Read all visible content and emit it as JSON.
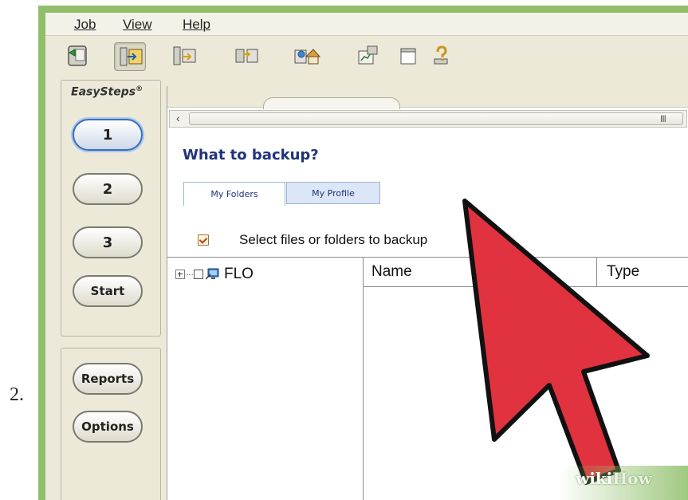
{
  "step_number": "2.",
  "menu": {
    "job": "Job",
    "view": "View",
    "help": "Help"
  },
  "toolbar_buttons": [
    {
      "icon": "back-icon"
    },
    {
      "icon": "backup-wizard-icon",
      "pressed": true
    },
    {
      "icon": "copy-files-icon"
    },
    {
      "icon": "sync-icon"
    },
    {
      "icon": "restore-home-icon"
    },
    {
      "icon": "report-chart-icon"
    },
    {
      "icon": "blank-window-icon"
    },
    {
      "icon": "help-icon"
    }
  ],
  "easysteps": {
    "title": "EasySteps",
    "registered": "®",
    "buttons": [
      "1",
      "2",
      "3",
      "Start"
    ],
    "active": "1",
    "lower_buttons": [
      "Reports",
      "Options"
    ]
  },
  "main": {
    "scroll_grip": "III",
    "scroll_left_arrow": "‹",
    "heading": "What to backup?",
    "tabs": [
      {
        "label": "My Folders",
        "selected": true
      },
      {
        "label": "My Profile",
        "selected": false
      }
    ],
    "select_label": "Select files or folders to backup",
    "tree": [
      {
        "label": "FLO",
        "expand": "+",
        "checked": false
      }
    ],
    "columns": [
      "Name",
      "Type"
    ]
  },
  "watermark": {
    "wiki": "wiki",
    "how": "How"
  },
  "colors": {
    "frame": "#8fbf6a",
    "heading": "#20337a",
    "cursor": "#e0323f"
  }
}
